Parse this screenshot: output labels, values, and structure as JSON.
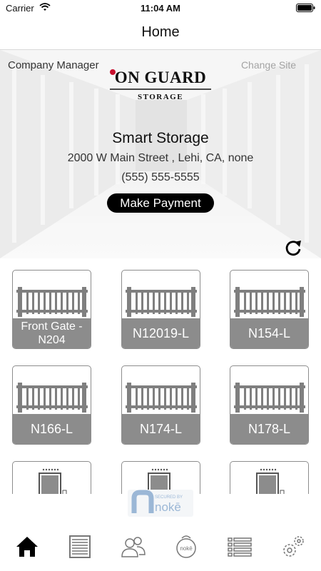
{
  "status_bar": {
    "carrier": "Carrier",
    "time": "11:04 AM"
  },
  "nav": {
    "title": "Home"
  },
  "hero": {
    "company_manager": "Company Manager",
    "change_site": "Change Site",
    "logo": {
      "line1": "ON GUARD",
      "line2": "STORAGE"
    },
    "site_name": "Smart Storage",
    "address": "2000 W Main Street , Lehi, CA, none",
    "phone": "(555) 555-5555",
    "make_payment": "Make Payment"
  },
  "units": [
    {
      "label": "Front Gate - N204",
      "icon": "gate-icon"
    },
    {
      "label": "N12019-L",
      "icon": "gate-icon"
    },
    {
      "label": "N154-L",
      "icon": "gate-icon"
    },
    {
      "label": "N166-L",
      "icon": "gate-icon"
    },
    {
      "label": "N174-L",
      "icon": "gate-icon"
    },
    {
      "label": "N178-L",
      "icon": "gate-icon"
    },
    {
      "icon": "door-icon"
    },
    {
      "icon": "door-icon"
    },
    {
      "icon": "door-icon"
    }
  ],
  "noke": {
    "secured_by": "SECURED BY",
    "brand": "nokē"
  },
  "tab_bar": [
    {
      "name": "home-icon",
      "active": true
    },
    {
      "name": "units-icon",
      "active": false
    },
    {
      "name": "users-icon",
      "active": false
    },
    {
      "name": "noke-lock-icon",
      "active": false
    },
    {
      "name": "list-icon",
      "active": false
    },
    {
      "name": "settings-icon",
      "active": false
    }
  ],
  "colors": {
    "tile_label_bg": "#8c8c8c",
    "tile_border": "#8d8d8d",
    "button_bg": "#000000",
    "logo_red": "#c8102e",
    "noke_blue": "#9bb7d6"
  }
}
